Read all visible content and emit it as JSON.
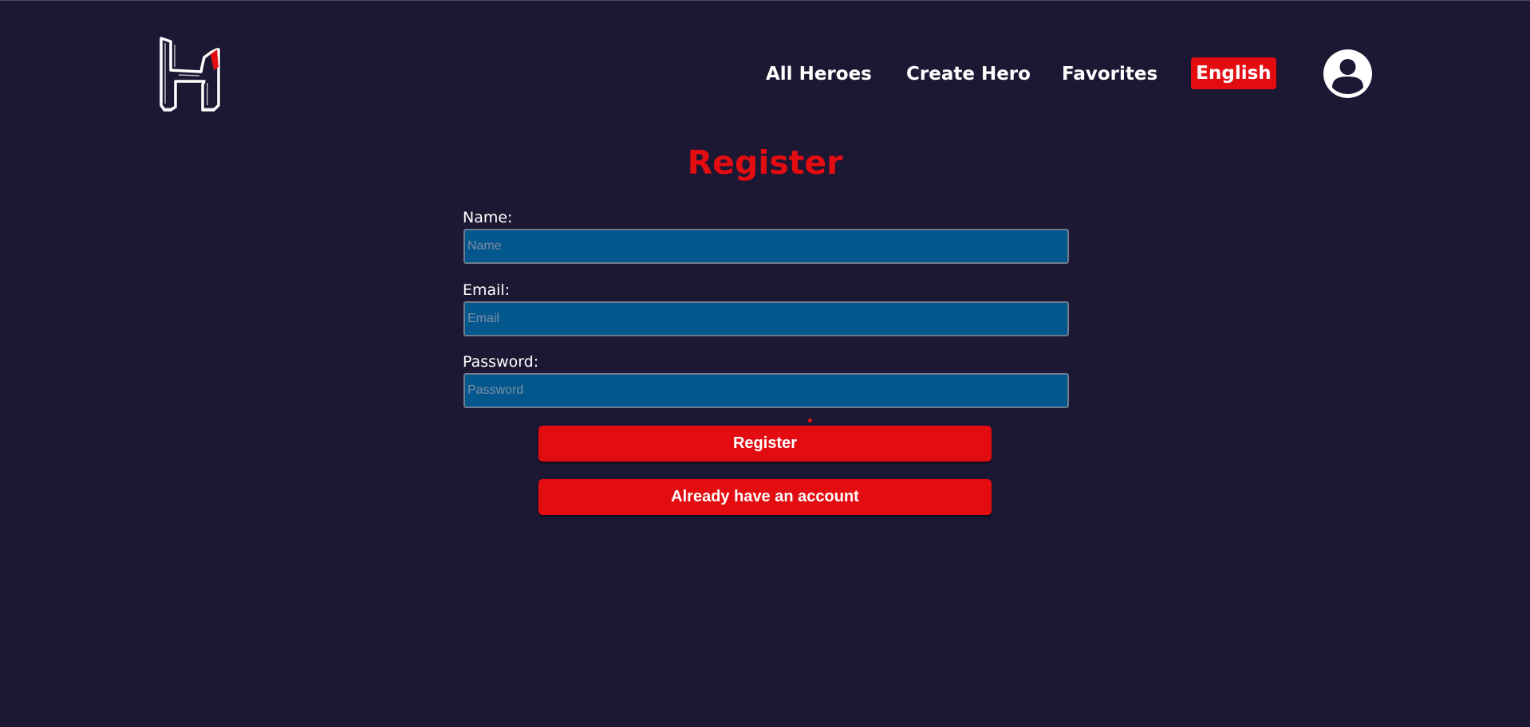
{
  "header": {
    "logo_icon": "hero-h-logo",
    "nav": [
      {
        "label": "All Heroes"
      },
      {
        "label": "Create Hero"
      },
      {
        "label": "Favorites"
      }
    ],
    "language_label": "English",
    "avatar_icon": "user-avatar-icon"
  },
  "form": {
    "title": "Register",
    "fields": [
      {
        "label": "Name:",
        "placeholder": "Name"
      },
      {
        "label": "Email:",
        "placeholder": "Email"
      },
      {
        "label": "Password:",
        "placeholder": "Password"
      }
    ],
    "register_label": "Register",
    "login_label": "Already have an account"
  },
  "colors": {
    "background": "#1c1732",
    "accent": "#e30d11",
    "input_background": "#03578d",
    "text": "#ffffff"
  }
}
